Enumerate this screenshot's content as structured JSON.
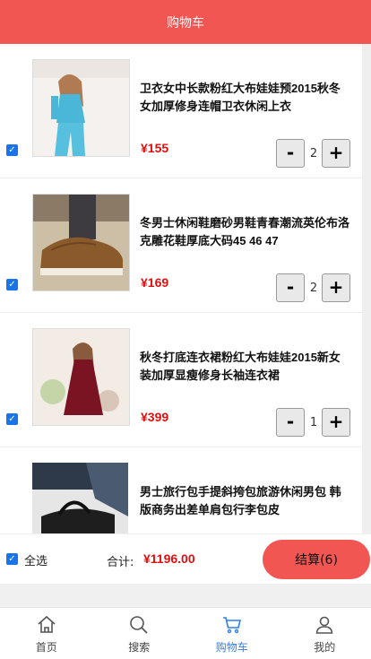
{
  "header": {
    "title": "购物车"
  },
  "currency": "¥",
  "items": [
    {
      "title": "卫衣女中长款粉红大布娃娃预2015秋冬女加厚修身连帽卫衣休闲上衣",
      "price": "155",
      "qty": "2",
      "checked": true,
      "image": "woman-in-blue-outfit"
    },
    {
      "title": "冬男士休闲鞋磨砂男鞋青春潮流英伦布洛克雕花鞋厚底大码45 46 47",
      "price": "169",
      "qty": "2",
      "checked": true,
      "image": "brown-brogue-shoe"
    },
    {
      "title": "秋冬打底连衣裙粉红大布娃娃2015新女装加厚显瘦修身长袖连衣裙",
      "price": "399",
      "qty": "1",
      "checked": true,
      "image": "woman-in-red-dress"
    },
    {
      "title": "男士旅行包手提斜挎包旅游休闲男包 韩版商务出差单肩包行李包皮",
      "price": "",
      "qty": "",
      "checked": false,
      "image": "black-leather-bag"
    }
  ],
  "stepper": {
    "minus": "-",
    "plus": "+"
  },
  "footer": {
    "select_all_label": "全选",
    "total_label": "合计:",
    "total_value": "¥1196.00",
    "checkout_label": "结算(6)"
  },
  "tabbar": [
    {
      "label": "首页",
      "icon": "home-icon",
      "active": false
    },
    {
      "label": "搜索",
      "icon": "search-icon",
      "active": false
    },
    {
      "label": "购物车",
      "icon": "cart-icon",
      "active": true
    },
    {
      "label": "我的",
      "icon": "user-icon",
      "active": false
    }
  ],
  "colors": {
    "accent": "#f25653",
    "price": "#e01010",
    "tab_active": "#2f7fe8",
    "checkbox": "#1a73e8"
  }
}
